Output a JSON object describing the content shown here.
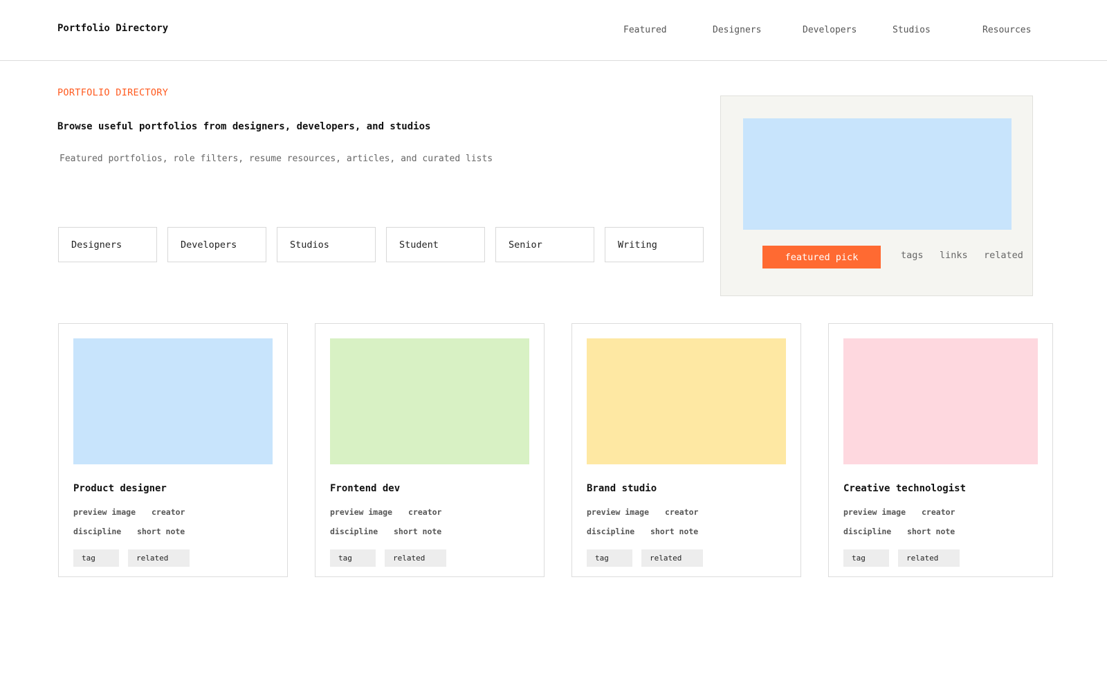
{
  "header": {
    "brand": "Portfolio Directory",
    "nav": [
      {
        "label": "Featured"
      },
      {
        "label": "Designers"
      },
      {
        "label": "Developers"
      },
      {
        "label": "Studios"
      },
      {
        "label": "Resources"
      }
    ]
  },
  "hero": {
    "eyebrow": "PORTFOLIO DIRECTORY",
    "headline": "Browse useful portfolios from designers, developers, and studios",
    "subtext": "Featured portfolios, role filters, resume resources, articles, and curated lists"
  },
  "filters": [
    {
      "label": "Designers"
    },
    {
      "label": "Developers"
    },
    {
      "label": "Studios"
    },
    {
      "label": "Student"
    },
    {
      "label": "Senior"
    },
    {
      "label": "Writing"
    }
  ],
  "featured": {
    "button_label": "featured pick",
    "links": [
      "tags",
      "links",
      "related"
    ],
    "image_color": "#c8e4fc"
  },
  "cards": [
    {
      "title": "Product designer",
      "meta1": "preview image",
      "meta2": "creator",
      "meta3": "discipline",
      "meta4": "short note",
      "tag1": "tag",
      "tag2": "related",
      "color": "#c8e4fc"
    },
    {
      "title": "Frontend dev",
      "meta1": "preview image",
      "meta2": "creator",
      "meta3": "discipline",
      "meta4": "short note",
      "tag1": "tag",
      "tag2": "related",
      "color": "#d8f1c4"
    },
    {
      "title": "Brand studio",
      "meta1": "preview image",
      "meta2": "creator",
      "meta3": "discipline",
      "meta4": "short note",
      "tag1": "tag",
      "tag2": "related",
      "color": "#fee8a3"
    },
    {
      "title": "Creative technologist",
      "meta1": "preview image",
      "meta2": "creator",
      "meta3": "discipline",
      "meta4": "short note",
      "tag1": "tag",
      "tag2": "related",
      "color": "#fed8df"
    }
  ],
  "colors": {
    "accent": "#ff5a1f",
    "button": "#ff6a32"
  }
}
